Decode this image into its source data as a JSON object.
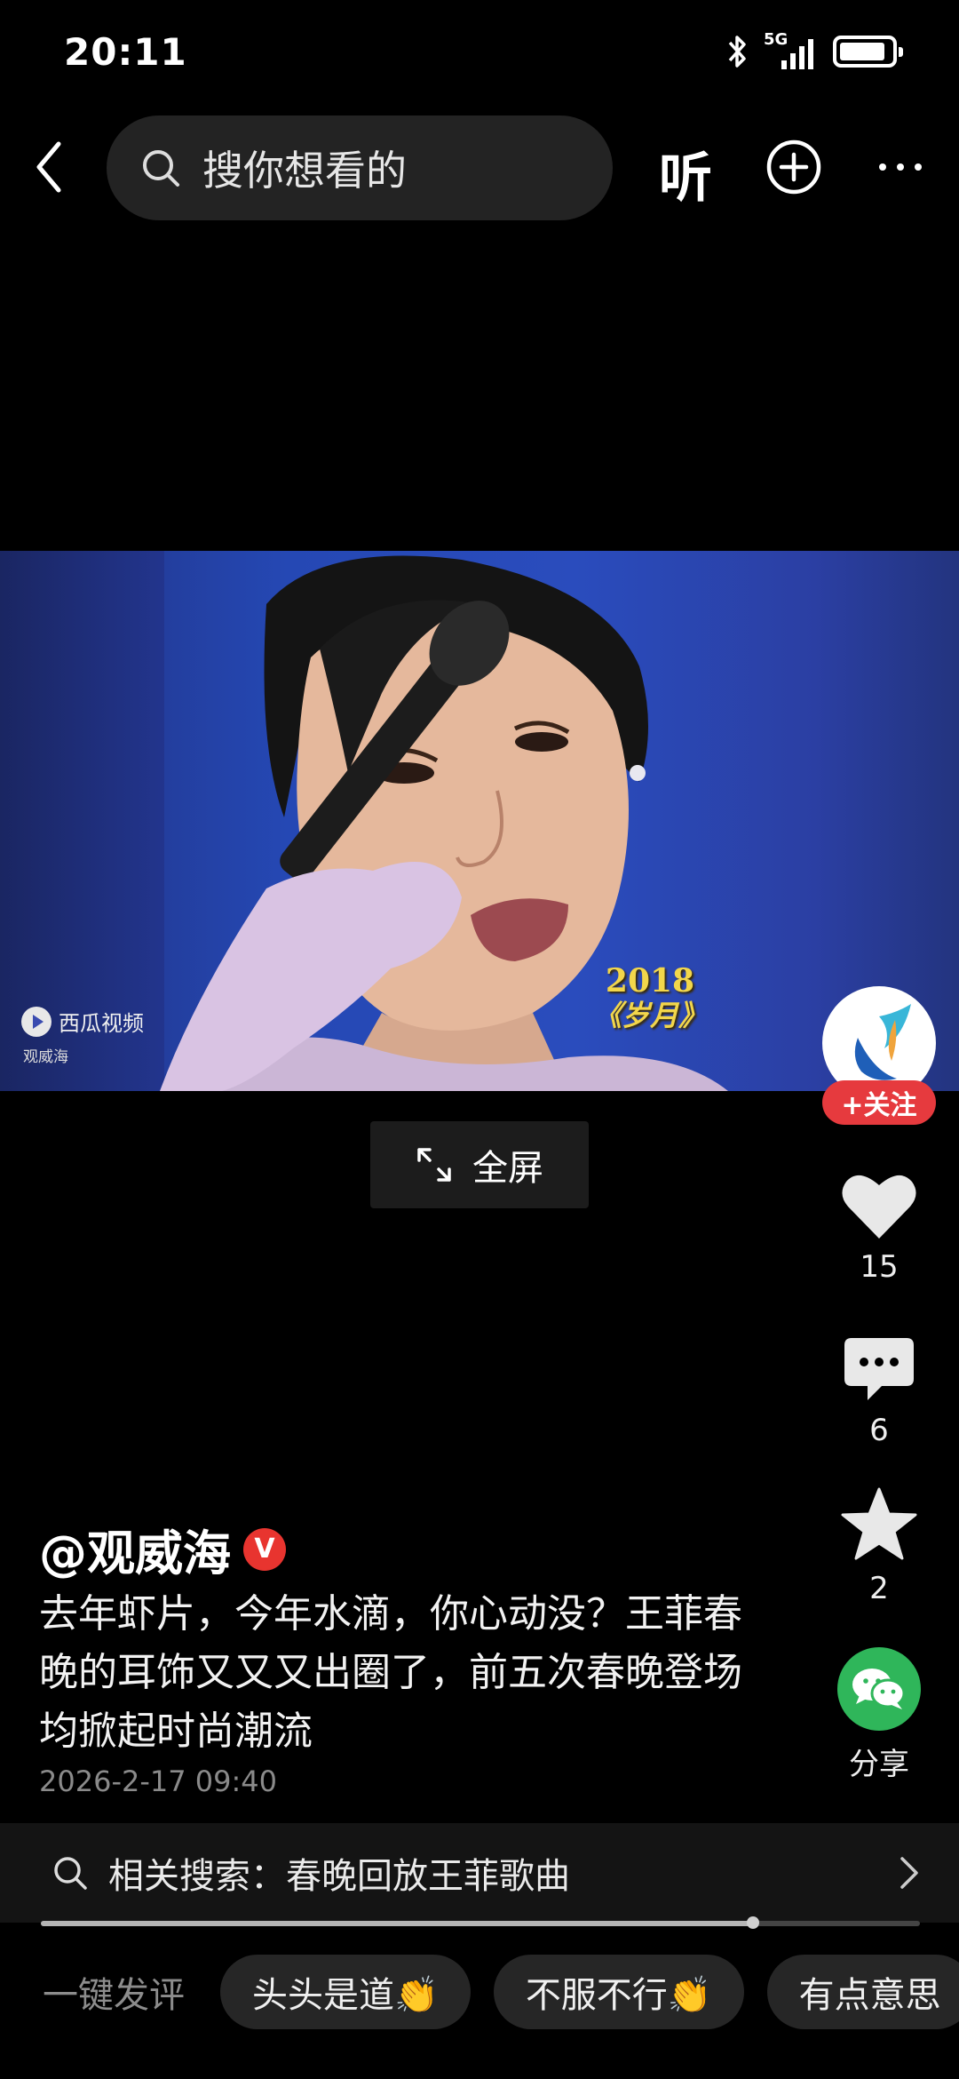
{
  "status_bar": {
    "time": "20:11",
    "network": "5G"
  },
  "nav": {
    "search_placeholder": "搜你想看的",
    "listen_label": "听"
  },
  "video": {
    "watermark_app": "西瓜视频",
    "watermark_user": "观威海",
    "caption_year": "2018",
    "caption_song": "《岁月》",
    "fullscreen_label": "全屏"
  },
  "rail": {
    "follow_label": "+关注",
    "likes": "15",
    "comments": "6",
    "favorites": "2",
    "share_label": "分享"
  },
  "post": {
    "author": "@观威海",
    "verified_mark": "V",
    "description": "去年虾片，今年水滴，你心动没？王菲春晚的耳饰又又又出圈了，前五次春晚登场均掀起时尚潮流",
    "date": "2026-2-17 09:40"
  },
  "related_search": {
    "text": "相关搜索：春晚回放王菲歌曲"
  },
  "playback": {
    "progress": 0.81
  },
  "quick_comments": {
    "label": "一键发评",
    "chips": [
      "头头是道👏",
      "不服不行👏",
      "有点意思"
    ]
  },
  "colors": {
    "follow": "#e63a3e",
    "share": "#2fb65a",
    "verified": "#e8342f"
  }
}
